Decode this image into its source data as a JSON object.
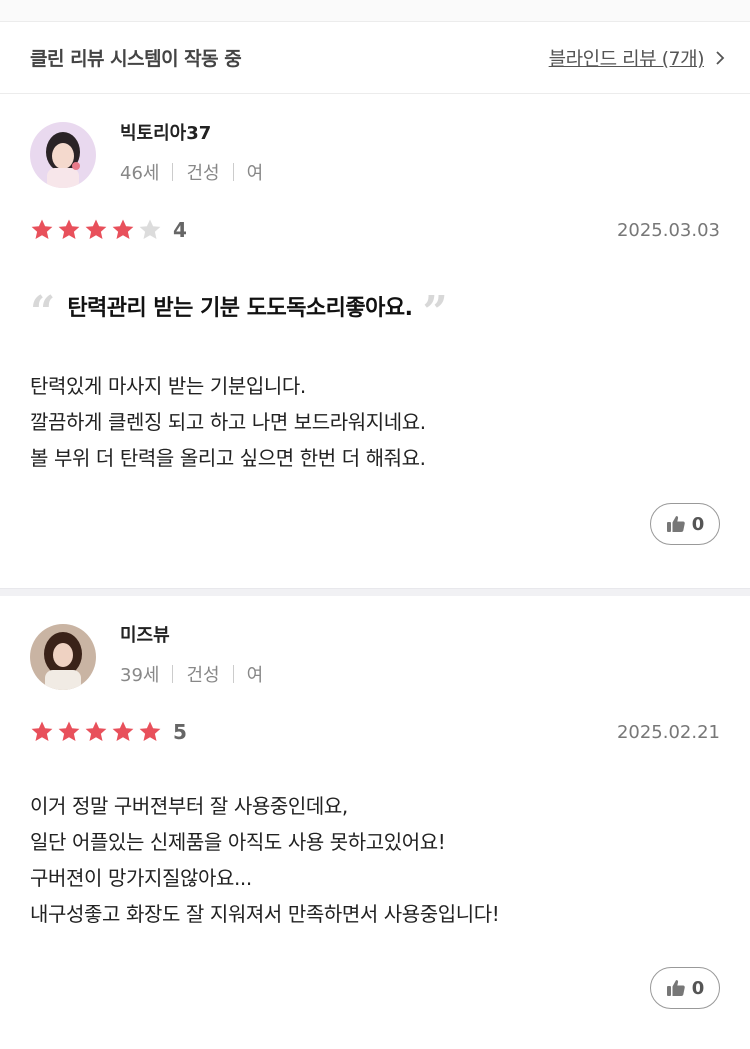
{
  "clean_review_bar": {
    "title": "클린 리뷰 시스템이 작동 중",
    "blind_link": "블라인드 리뷰 (7개)"
  },
  "reviews": [
    {
      "nickname": "빅토리아37",
      "age": "46세",
      "skin_type": "건성",
      "gender": "여",
      "rating": 4,
      "rating_text": "4",
      "date": "2025.03.03",
      "headline": "탄력관리 받는 기분 도도독소리좋아요.",
      "body_lines": [
        "탄력있게 마사지 받는 기분입니다.",
        "깔끔하게 클렌징 되고 하고 나면 보드라워지네요.",
        "볼 부위 더 탄력을 올리고 싶으면 한번 더 해줘요."
      ],
      "likes": "0"
    },
    {
      "nickname": "미즈뷰",
      "age": "39세",
      "skin_type": "건성",
      "gender": "여",
      "rating": 5,
      "rating_text": "5",
      "date": "2025.02.21",
      "body_lines": [
        "이거 정말 구버젼부터 잘 사용중인데요,",
        "일단 어플있는 신제품을 아직도 사용 못하고있어요!",
        "구버젼이 망가지질않아요...",
        "내구성좋고 화장도 잘 지워져서 만족하면서 사용중입니다!"
      ],
      "likes": "0"
    }
  ],
  "colors": {
    "star_filled": "#e8505b",
    "star_empty": "#dcdcdc",
    "quote_mark": "#d8d8d8"
  },
  "icons": {
    "like": "thumbs-up-icon",
    "chevron": "chevron-right-icon",
    "star": "star-icon"
  }
}
